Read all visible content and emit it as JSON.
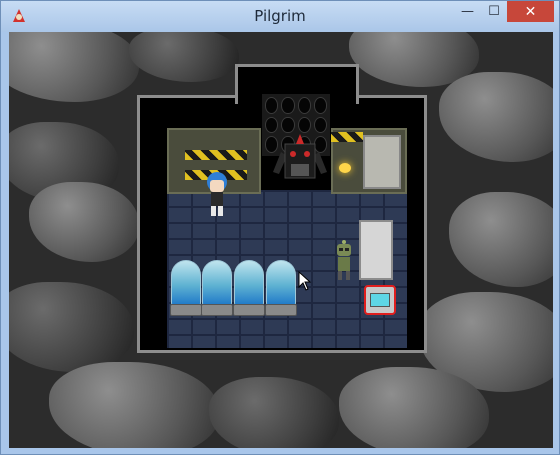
{
  "window": {
    "title": "Pilgrim",
    "minimize_glyph": "—",
    "maximize_glyph": "☐",
    "close_glyph": "✕",
    "app_icon": "rpg-maker-icon"
  },
  "scene": {
    "cave_background": "dark-rocky-cave",
    "room": "laboratory",
    "player": "blue-haired-girl-sprite",
    "npc": "small-robot",
    "highlighted_object": "computer-terminal",
    "highlight_color": "#e01e1e",
    "tube_count": 4,
    "tube_liquid_color": "#1f78c8",
    "floor_color": "#2e3a55"
  }
}
